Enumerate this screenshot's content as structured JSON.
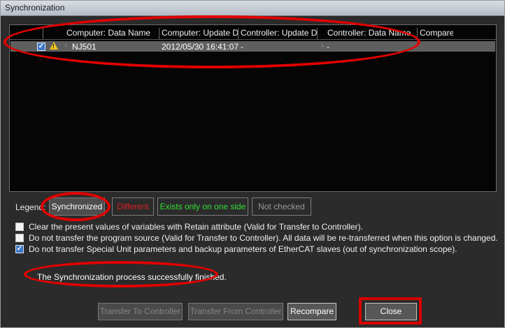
{
  "window": {
    "title": "Synchronization"
  },
  "table": {
    "columns": [
      "Computer: Data Name",
      "Computer: Update Da",
      "Controller: Update Da",
      "Controller: Data Name",
      "Compare"
    ],
    "rows": [
      {
        "checked": true,
        "status": "warning-icon",
        "computer_data_name": "NJ501",
        "computer_update": "2012/05/30 16:41:07",
        "controller_update": "-",
        "controller_data_name": "-",
        "compare": ""
      }
    ]
  },
  "legend": {
    "label": "Legend:",
    "synchronized": "Synchronized",
    "different": "Different",
    "one_side": "Exists only on one side",
    "not_checked": "Not checked",
    "colors": {
      "synchronized": "#ffffff",
      "different": "#e02020",
      "one_side": "#33e033",
      "not_checked": "#9a9a9a"
    }
  },
  "options": [
    {
      "checked": false,
      "label": "Clear the present values of variables with Retain attribute (Valid for Transfer to Controller)."
    },
    {
      "checked": false,
      "label": "Do not transfer the program source (Valid for Transfer to Controller). All data will be re-transferred when this option is changed."
    },
    {
      "checked": true,
      "label": "Do not transfer Special Unit parameters and backup parameters of EtherCAT slaves (out of synchronization scope)."
    }
  ],
  "status_message": "The Synchronization process successfully finished.",
  "buttons": {
    "transfer_to": "Transfer To Controller",
    "transfer_from": "Transfer From Controller",
    "recompare": "Recompare",
    "close": "Close"
  },
  "colors": {
    "annotation": "#e10000",
    "window_bg": "#2b2b2b",
    "selected_row": "#5f5f5f"
  }
}
